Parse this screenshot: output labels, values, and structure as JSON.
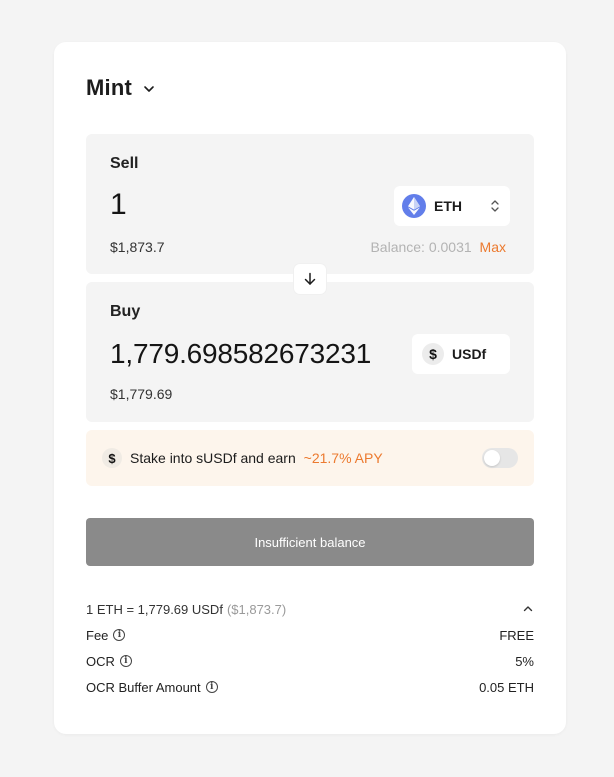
{
  "header": {
    "title": "Mint"
  },
  "sell": {
    "label": "Sell",
    "amount": "1",
    "fiat": "$1,873.7",
    "token": "ETH",
    "balance_label": "Balance:",
    "balance_value": "0.0031",
    "max_label": "Max"
  },
  "buy": {
    "label": "Buy",
    "amount": "1,779.698582673231",
    "fiat": "$1,779.69",
    "token": "USDf"
  },
  "stake": {
    "text": "Stake into sUSDf and earn",
    "apy": "~21.7% APY",
    "enabled": false
  },
  "cta": {
    "label": "Insufficient balance"
  },
  "details": {
    "rate": "1 ETH = 1,779.69 USDf",
    "rate_fiat": "($1,873.7)",
    "rows": [
      {
        "label": "Fee",
        "value": "FREE"
      },
      {
        "label": "OCR",
        "value": "5%"
      },
      {
        "label": "OCR Buffer Amount",
        "value": "0.05 ETH"
      }
    ]
  },
  "colors": {
    "accent": "#ec7a2f",
    "eth": "#627eea",
    "cta_disabled": "#8a8a8a",
    "stake_bg": "#fdf5ec"
  }
}
